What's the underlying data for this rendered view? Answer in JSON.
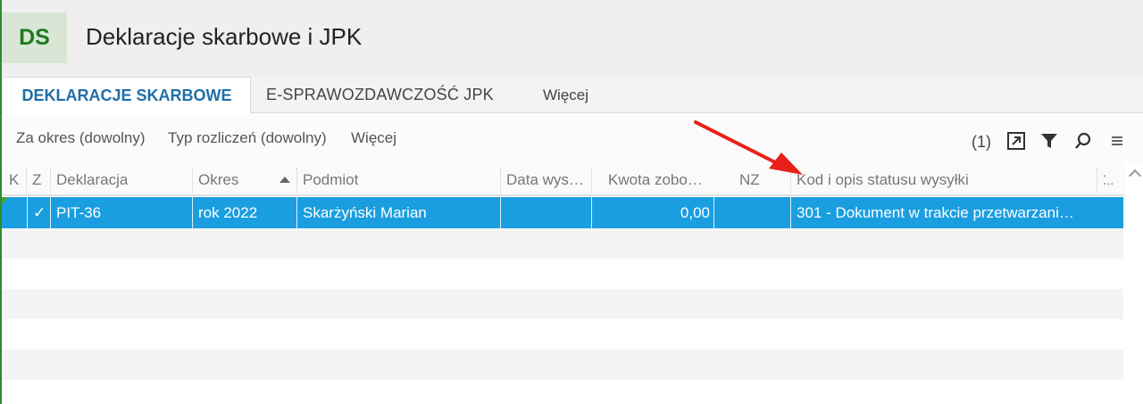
{
  "header": {
    "logo": "DS",
    "title": "Deklaracje skarbowe i JPK"
  },
  "tabs": [
    {
      "label": "DEKLARACJE SKARBOWE",
      "active": true
    },
    {
      "label": "E-SPRAWOZDAWCZOŚĆ JPK",
      "active": false
    },
    {
      "label": "Więcej",
      "active": false
    }
  ],
  "filters": {
    "period": "Za okres (dowolny)",
    "settlement_type": "Typ rozliczeń (dowolny)",
    "more": "Więcej",
    "count": "(1)"
  },
  "toolbar_icons": [
    "export-icon",
    "filter-icon",
    "search-icon",
    "menu-icon"
  ],
  "grid": {
    "columns": [
      "K",
      "Z",
      "Deklaracja",
      "Okres",
      "Podmiot",
      "Data wys…",
      "Kwota zobo…",
      "NZ",
      "Kod i opis statusu wysyłki",
      "⁚.."
    ],
    "sort": {
      "column": "Okres",
      "direction": "asc"
    },
    "rows": [
      {
        "k": "",
        "z": "✓",
        "deklaracja": "PIT-36",
        "okres": "rok 2022",
        "podmiot": "Skarżyński Marian",
        "data_wysylki": "",
        "kwota": "0,00",
        "nz": "",
        "status": "301 - Dokument w trakcie przetwarzani…",
        "selected": true
      }
    ]
  },
  "colors": {
    "accent": "#1f6fa8",
    "selection": "#1a9ee0",
    "logo_text": "#1f7a1f",
    "annotation_arrow": "#e8201a"
  }
}
